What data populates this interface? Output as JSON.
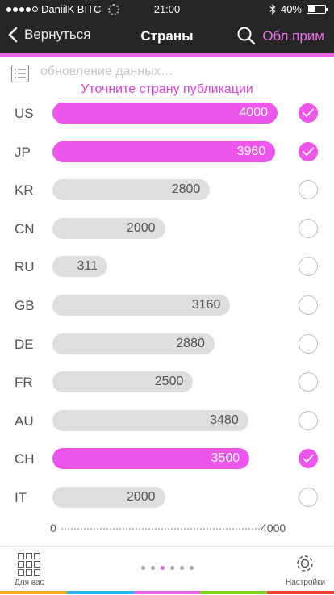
{
  "status_bar": {
    "carrier": "DaniilK BITC",
    "time": "21:00",
    "battery": "40%",
    "signal_dots_filled": 4,
    "battery_level": 0.4
  },
  "nav": {
    "back_label": "Вернуться",
    "title": "Страны",
    "action_label": "Обл.прим"
  },
  "colors": {
    "accent": "#e963e4",
    "bar_selected": "#ee55ec",
    "bar_unselected": "#dedede",
    "dark_bar": "#262626"
  },
  "content": {
    "updating": "обновление данных…",
    "hint": "Уточните страну публикации"
  },
  "chart_data": {
    "type": "bar",
    "orientation": "horizontal",
    "xlim": [
      0,
      4000
    ],
    "categories": [
      "US",
      "JP",
      "KR",
      "CN",
      "RU",
      "GB",
      "DE",
      "FR",
      "AU",
      "CH",
      "IT"
    ],
    "values": [
      4000,
      3960,
      2800,
      2000,
      311,
      3160,
      2880,
      2500,
      3480,
      3500,
      2000
    ],
    "selected": [
      true,
      true,
      false,
      false,
      false,
      false,
      false,
      false,
      false,
      true,
      false
    ]
  },
  "axis": {
    "min_label": "0",
    "max_label": "4000"
  },
  "tabs": {
    "for_you": "Для вас",
    "settings": "Настройки"
  },
  "pager": {
    "count": 6,
    "active": 2
  }
}
